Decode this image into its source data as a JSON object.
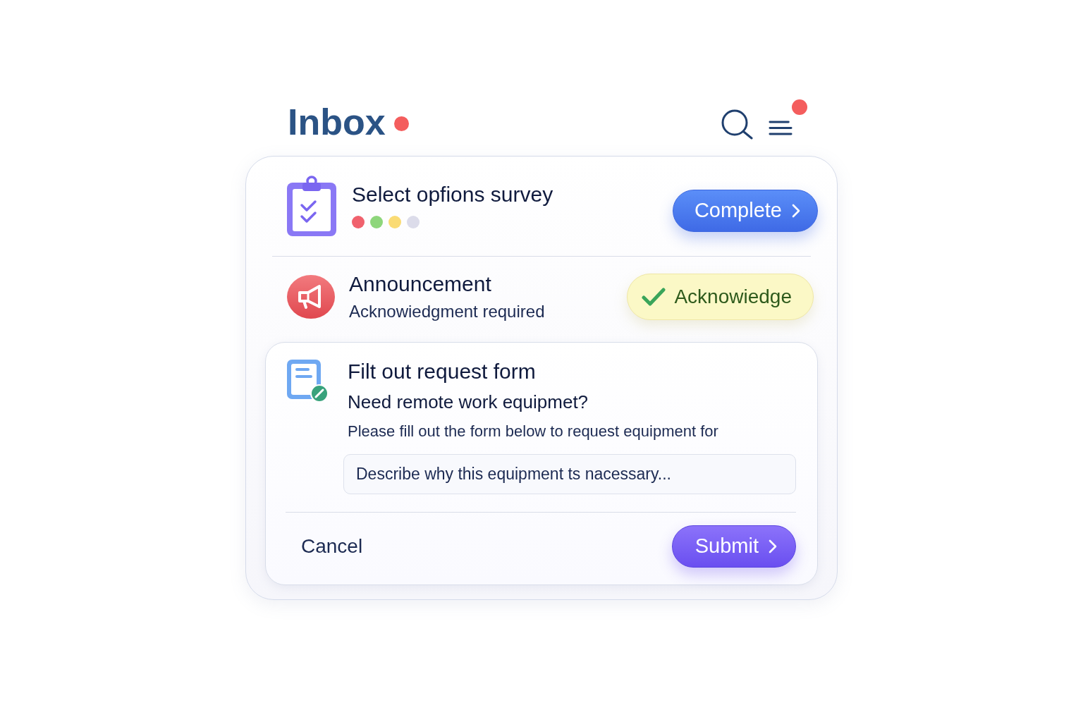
{
  "header": {
    "title": "Inbox",
    "unread": true,
    "menu_notification": true
  },
  "items": [
    {
      "kind": "survey",
      "title": "Select opfions survey",
      "dots": [
        {
          "color": "#f0616d"
        },
        {
          "color": "#8ed67b"
        },
        {
          "color": "#fadb74"
        },
        {
          "color": "#dcdcea"
        }
      ],
      "action": "Complete"
    },
    {
      "kind": "announcement",
      "title": "Announcement",
      "subtitle": "Acknowiedgment required",
      "action": "Acknowiedge"
    },
    {
      "kind": "form",
      "title": "Filt out request form",
      "question": "Need remote work equipmet?",
      "description": "Please fill out the form below to request equipment for",
      "field": {
        "placeholder": "Describe why this equipment ts nacessary..."
      },
      "cancel": "Cancel",
      "submit": "Submit"
    }
  ]
}
